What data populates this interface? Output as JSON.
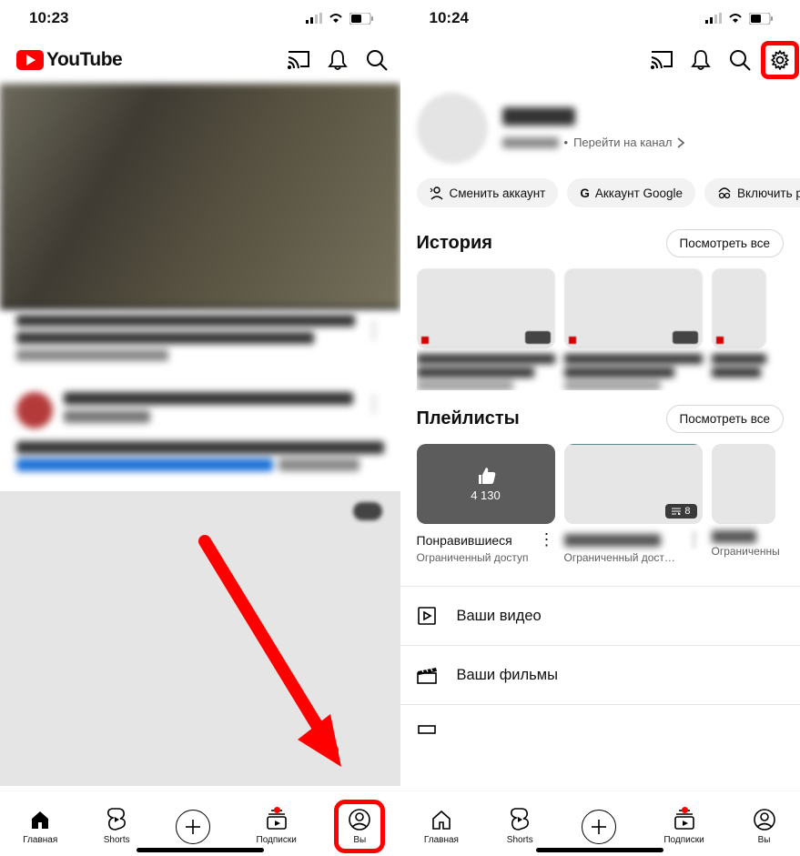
{
  "left": {
    "status_time": "10:23",
    "app_name": "YouTube",
    "nav": {
      "home": "Главная",
      "shorts": "Shorts",
      "subs": "Подписки",
      "you": "Вы"
    }
  },
  "right": {
    "status_time": "10:24",
    "channel_link": "Перейти на канал",
    "chips": {
      "switch": "Сменить аккаунт",
      "google": "Аккаунт Google",
      "incognito": "Включить р"
    },
    "history": {
      "title": "История",
      "see_all": "Посмотреть все"
    },
    "playlists": {
      "title": "Плейлисты",
      "see_all": "Посмотреть все",
      "liked_title": "Понравившиеся",
      "liked_count": "4 130",
      "liked_sub": "Ограниченный доступ",
      "p2_sub": "Ограниченный дост…",
      "p2_badge": "8",
      "p3_sub": "Ограниченны"
    },
    "menu": {
      "videos": "Ваши видео",
      "movies": "Ваши фильмы"
    },
    "nav": {
      "home": "Главная",
      "shorts": "Shorts",
      "subs": "Подписки",
      "you": "Вы"
    }
  }
}
